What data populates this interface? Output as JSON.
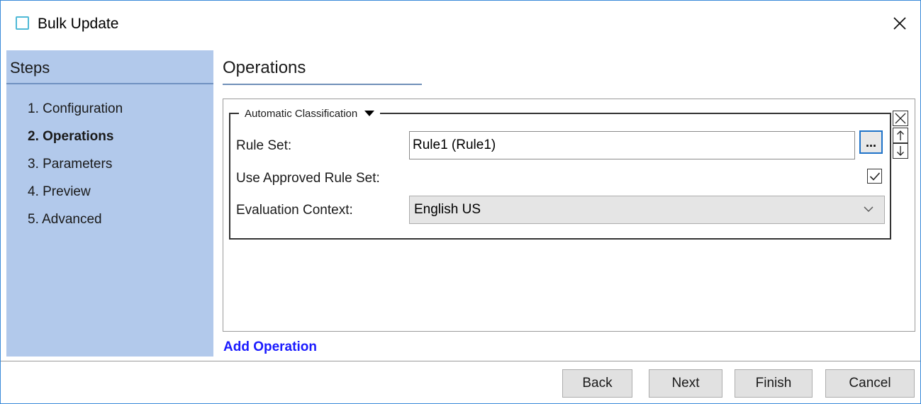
{
  "window": {
    "title": "Bulk Update"
  },
  "sidebar": {
    "title": "Steps",
    "steps": [
      {
        "label": "1. Configuration"
      },
      {
        "label": "2. Operations"
      },
      {
        "label": "3. Parameters"
      },
      {
        "label": "4. Preview"
      },
      {
        "label": "5. Advanced"
      }
    ],
    "active_step": "2. Operations"
  },
  "main": {
    "section_title": "Operations",
    "operation": {
      "legend": "Automatic Classification",
      "rule_set_label": "Rule Set:",
      "rule_set_value": "Rule1 (Rule1)",
      "browse_label": "...",
      "approved_label": "Use Approved Rule Set:",
      "approved_checked": true,
      "context_label": "Evaluation Context:",
      "context_value": "English US"
    },
    "add_operation": "Add Operation"
  },
  "footer": {
    "back": "Back",
    "next": "Next",
    "finish": "Finish",
    "cancel": "Cancel"
  },
  "colors": {
    "sidebar_bg": "#b2c9eb",
    "link": "#1a1aff",
    "focus_border": "#1f73c9"
  }
}
